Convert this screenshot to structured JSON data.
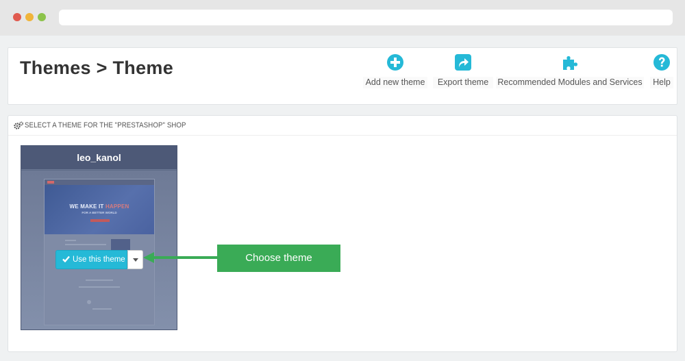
{
  "header": {
    "title": "Themes > Theme"
  },
  "toolbar": {
    "add_new_theme": "Add new theme",
    "export_theme": "Export theme",
    "recommended_modules": "Recommended Modules and Services",
    "help": "Help"
  },
  "panel": {
    "title": "SELECT A THEME FOR THE \"PRESTASHOP\" SHOP"
  },
  "theme": {
    "name": "leo_kanol",
    "use_button_label": "Use this theme",
    "preview_headline_a": "WE MAKE IT ",
    "preview_headline_b": "HAPPEN",
    "preview_subline": "FOR A BETTER WORLD"
  },
  "annotation": {
    "callout": "Choose theme"
  },
  "colors": {
    "accent": "#25b9d7",
    "callout_green": "#3aab56",
    "card": "#5d6b86"
  },
  "icons": {
    "add": "plus-circle-icon",
    "export": "share-icon",
    "modules": "puzzle-icon",
    "help": "question-circle-icon",
    "panel": "gears-icon",
    "use": "check-icon",
    "dropdown": "caret-down-icon"
  }
}
